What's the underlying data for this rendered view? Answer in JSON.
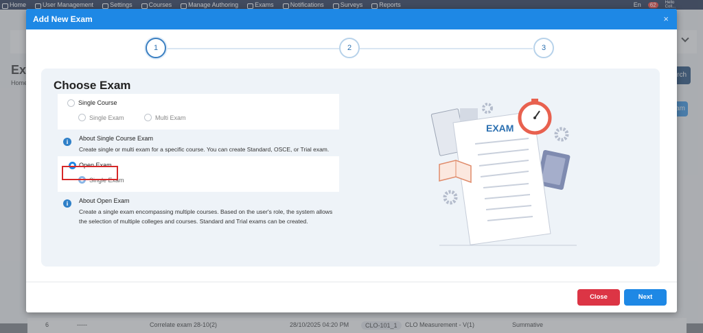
{
  "topnav": {
    "items": [
      "Home",
      "User Management",
      "Settings",
      "Courses",
      "Manage Authoring",
      "Exams",
      "Notifications",
      "Surveys",
      "Reports"
    ],
    "language": "En",
    "notification_count": "62",
    "greeting": "Hello",
    "user_name": "Coll..."
  },
  "background": {
    "page_title": "Exa",
    "breadcrumb": "Home",
    "search_label": "earch",
    "action_label": "am",
    "row": {
      "index": "6",
      "dashes": "-----",
      "name": "Correlate exam 28-10(2)",
      "date": "28/10/2025 04:20 PM",
      "code": "CLO-101_1",
      "type": "CLO Measurement - V(1)",
      "category": "Summative"
    }
  },
  "modal": {
    "title": "Add New Exam",
    "close_symbol": "×",
    "steps": [
      "1",
      "2",
      "3"
    ],
    "heading": "Choose Exam",
    "single_course": {
      "label": "Single Course",
      "sub_options": [
        "Single Exam",
        "Multi Exam"
      ]
    },
    "single_course_info": {
      "title": "About Single Course Exam",
      "description": "Create single or multi exam for a specific course. You can create Standard, OSCE, or Trial exam."
    },
    "open_exam": {
      "label": "Open Exam",
      "selected": true,
      "sub_options": [
        "Single Exam"
      ]
    },
    "open_exam_info": {
      "title": "About Open Exam",
      "description": "Create a single exam encompassing multiple courses. Based on the user's role, the system allows the selection of multiple colleges and courses. Standard and Trial exams can be created."
    },
    "illustration": {
      "label": "EXAM"
    },
    "buttons": {
      "close": "Close",
      "next": "Next"
    },
    "colors": {
      "header": "#1e88e5",
      "close_button": "#dc3545",
      "next_button": "#1e88e5",
      "highlight": "#d62828"
    }
  }
}
